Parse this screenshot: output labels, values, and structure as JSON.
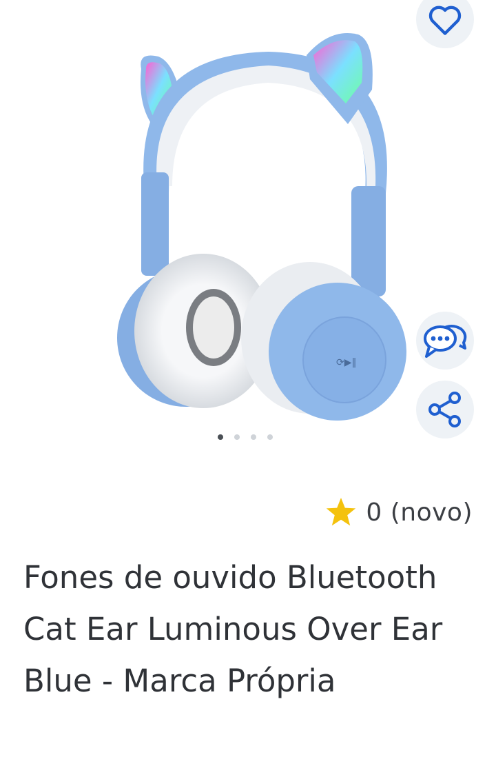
{
  "product": {
    "title": "Fones de ouvido Bluetooth Cat Ear Luminous Over Ear Blue - Marca Própria",
    "rating_text": "0 (novo)",
    "image_alt": "Fones de ouvido azuis com orelhas de gato luminosas"
  },
  "gallery": {
    "total_images": 4,
    "active_index": 0
  },
  "actions": {
    "favorite_icon": "heart-icon",
    "chat_icon": "chat-bubbles-icon",
    "share_icon": "share-icon"
  },
  "colors": {
    "accent": "#1f5fd0",
    "star": "#f4c20d",
    "headphone_blue": "#8fb8ea"
  }
}
